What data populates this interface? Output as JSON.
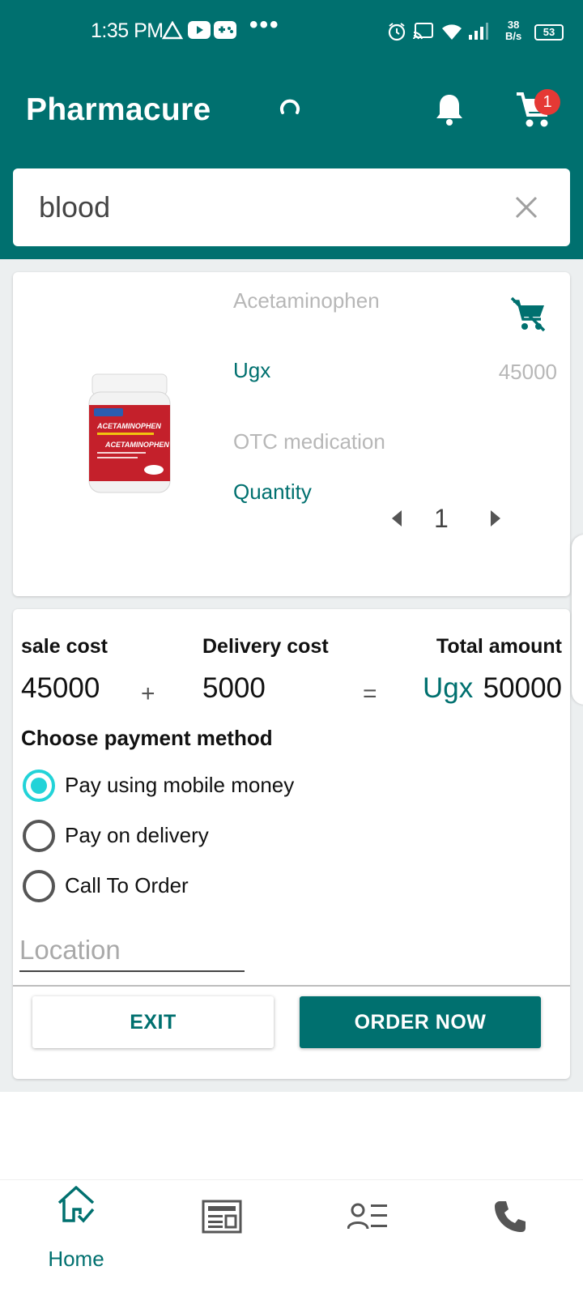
{
  "status_bar": {
    "time": "1:35 PM",
    "net_speed_value": "38",
    "net_speed_unit": "B/s",
    "battery": "53"
  },
  "header": {
    "title": "Pharmacure",
    "cart_count": "1"
  },
  "search": {
    "value": "blood"
  },
  "product": {
    "name": "Acetaminophen",
    "currency": "Ugx",
    "price": "45000",
    "category": "OTC medication",
    "quantity_label": "Quantity",
    "quantity": "1",
    "image_label_1": "ACETAMINOPHEN",
    "image_label_2": "ACETAMINOPHEN"
  },
  "summary": {
    "sale_cost_label": "sale cost",
    "delivery_cost_label": "Delivery cost",
    "total_amount_label": "Total amount",
    "sale_cost": "45000",
    "plus": "+",
    "delivery_cost": "5000",
    "equals": "=",
    "total_currency": "Ugx",
    "total": "50000"
  },
  "payment": {
    "title": "Choose payment method",
    "options": [
      {
        "label": "Pay using mobile money",
        "selected": true
      },
      {
        "label": "Pay on delivery",
        "selected": false
      },
      {
        "label": "Call To Order",
        "selected": false
      }
    ],
    "location_placeholder": "Location"
  },
  "actions": {
    "exit": "EXIT",
    "order": "ORDER NOW"
  },
  "bottom_nav": {
    "home_label": "Home",
    "icons": [
      "home-icon",
      "news-icon",
      "profile-list-icon",
      "phone-icon"
    ]
  },
  "colors": {
    "primary": "#00706f",
    "radio_accent": "#22d3d8",
    "badge": "#e53935"
  }
}
